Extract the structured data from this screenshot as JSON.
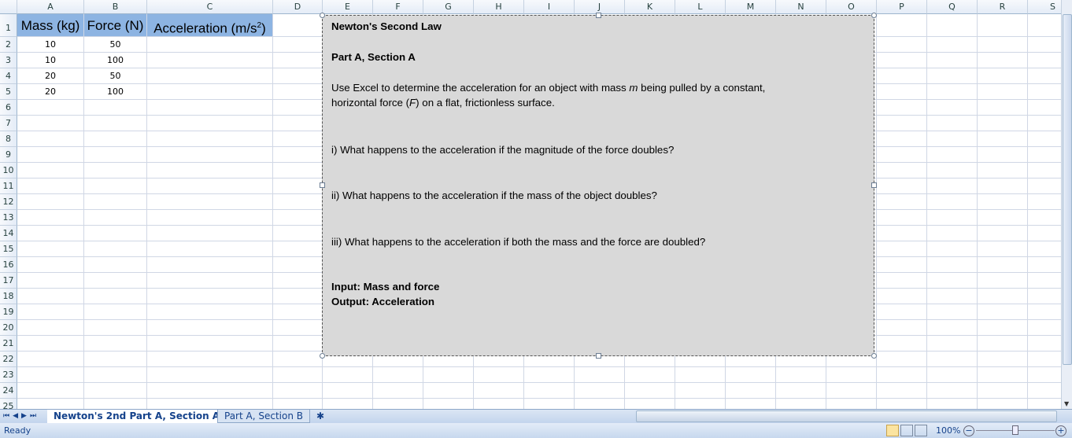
{
  "columns": [
    "A",
    "B",
    "C",
    "D",
    "E",
    "F",
    "G",
    "H",
    "I",
    "J",
    "K",
    "L",
    "M",
    "N",
    "O",
    "P",
    "Q",
    "R",
    "S"
  ],
  "rows": 25,
  "headers": {
    "mass": "Mass (kg)",
    "force": "Force (N)",
    "accel": "Acceleration (m/s",
    "accel_sup": "2",
    "accel_close": ")"
  },
  "table": [
    [
      "10",
      "50"
    ],
    [
      "10",
      "100"
    ],
    [
      "20",
      "50"
    ],
    [
      "20",
      "100"
    ]
  ],
  "textbox": {
    "title": "Newton's Second Law",
    "part": "Part A, Section A",
    "intro_1": "Use Excel to determine the acceleration for an object with mass ",
    "intro_m": "m",
    "intro_2": " being pulled by a constant,",
    "intro_3": "horizontal force (",
    "intro_f": "F",
    "intro_4": ") on a flat, frictionless surface.",
    "q1": "i) What happens to the acceleration if the magnitude of the force doubles?",
    "q2": "ii) What happens to the acceleration if the mass of the object doubles?",
    "q3": "iii) What happens to the acceleration if both the mass and the force are doubled?",
    "input": "Input: Mass and force",
    "output": "Output: Acceleration"
  },
  "sheets": [
    {
      "label": "Newton's 2nd Part A, Section A",
      "active": true
    },
    {
      "label": "Part A, Section B",
      "active": false
    }
  ],
  "status": {
    "ready": "Ready",
    "zoom": "100%"
  }
}
